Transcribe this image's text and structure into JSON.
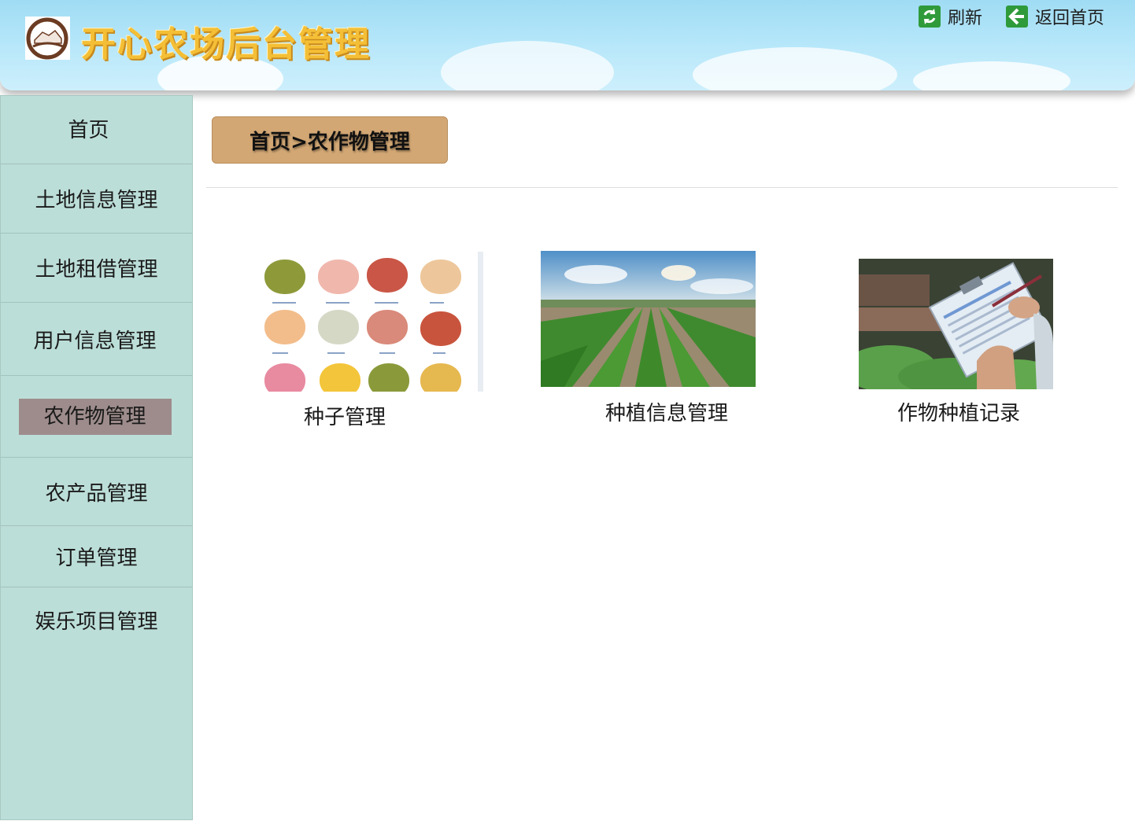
{
  "header": {
    "title": "开心农场后台管理",
    "refresh_label": "刷新",
    "home_label": "返回首页"
  },
  "sidebar": {
    "items": [
      {
        "label": "首页"
      },
      {
        "label": "土地信息管理"
      },
      {
        "label": "土地租借管理"
      },
      {
        "label": "用户信息管理"
      },
      {
        "label": "农作物管理",
        "active": true
      },
      {
        "label": "农产品管理"
      },
      {
        "label": "订单管理"
      },
      {
        "label": "娱乐项目管理"
      }
    ]
  },
  "breadcrumb": "首页>农作物管理",
  "cards": [
    {
      "label": "种子管理",
      "image": "seeds-photo"
    },
    {
      "label": "种植信息管理",
      "image": "field-photo"
    },
    {
      "label": "作物种植记录",
      "image": "clipboard-photo"
    }
  ],
  "colors": {
    "sidebar_bg": "#bcded8",
    "active_item_bg": "#9e8c8c",
    "breadcrumb_bg": "#d2a774",
    "title_color": "#f4bf36",
    "icon_green": "#2f9a3a"
  }
}
